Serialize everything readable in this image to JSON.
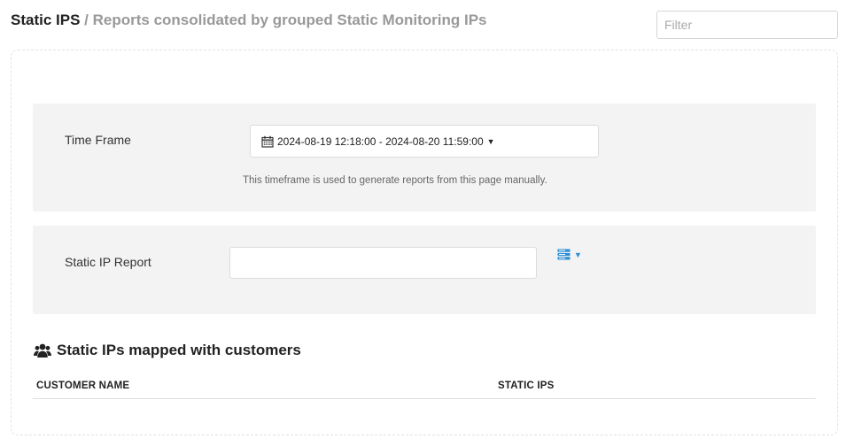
{
  "header": {
    "title": "Static IPS",
    "separator": "/",
    "subtitle": "Reports consolidated by grouped Static Monitoring IPs"
  },
  "filter": {
    "placeholder": "Filter",
    "value": ""
  },
  "timeframe": {
    "label": "Time Frame",
    "range": "2024-08-19 12:18:00 - 2024-08-20 11:59:00",
    "hint": "This timeframe is used to generate reports from this page manually."
  },
  "report": {
    "label": "Static IP Report",
    "value": ""
  },
  "customers": {
    "title": "Static IPs mapped with customers",
    "columns": [
      "CUSTOMER NAME",
      "STATIC IPS"
    ],
    "rows": []
  },
  "colors": {
    "accent": "#2b8fd6",
    "panel_bg": "#f2f3f2"
  },
  "icons": {
    "calendar": "calendar-icon",
    "caret": "caret-down-icon",
    "report_menu": "server-stack-icon",
    "users": "users-icon"
  }
}
